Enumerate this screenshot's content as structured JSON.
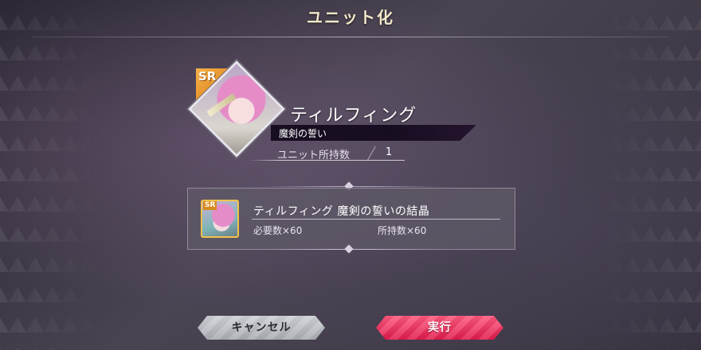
{
  "header": {
    "title": "ユニット化"
  },
  "unit": {
    "rarity": "SR",
    "name": "ティルフィング",
    "subtitle": "魔剣の誓い",
    "owned_label": "ユニット所持数",
    "owned_value": "1"
  },
  "material": {
    "rarity": "SR",
    "name": "ティルフィング 魔剣の誓いの結晶",
    "required": "必要数×60",
    "owned": "所持数×60"
  },
  "buttons": {
    "cancel": "キャンセル",
    "execute": "実行"
  },
  "colors": {
    "execute_button": "#e01c4c",
    "cancel_button": "#b9bcc1",
    "title_text": "#f3e9c9",
    "rarity_badge": "#e8931f"
  }
}
